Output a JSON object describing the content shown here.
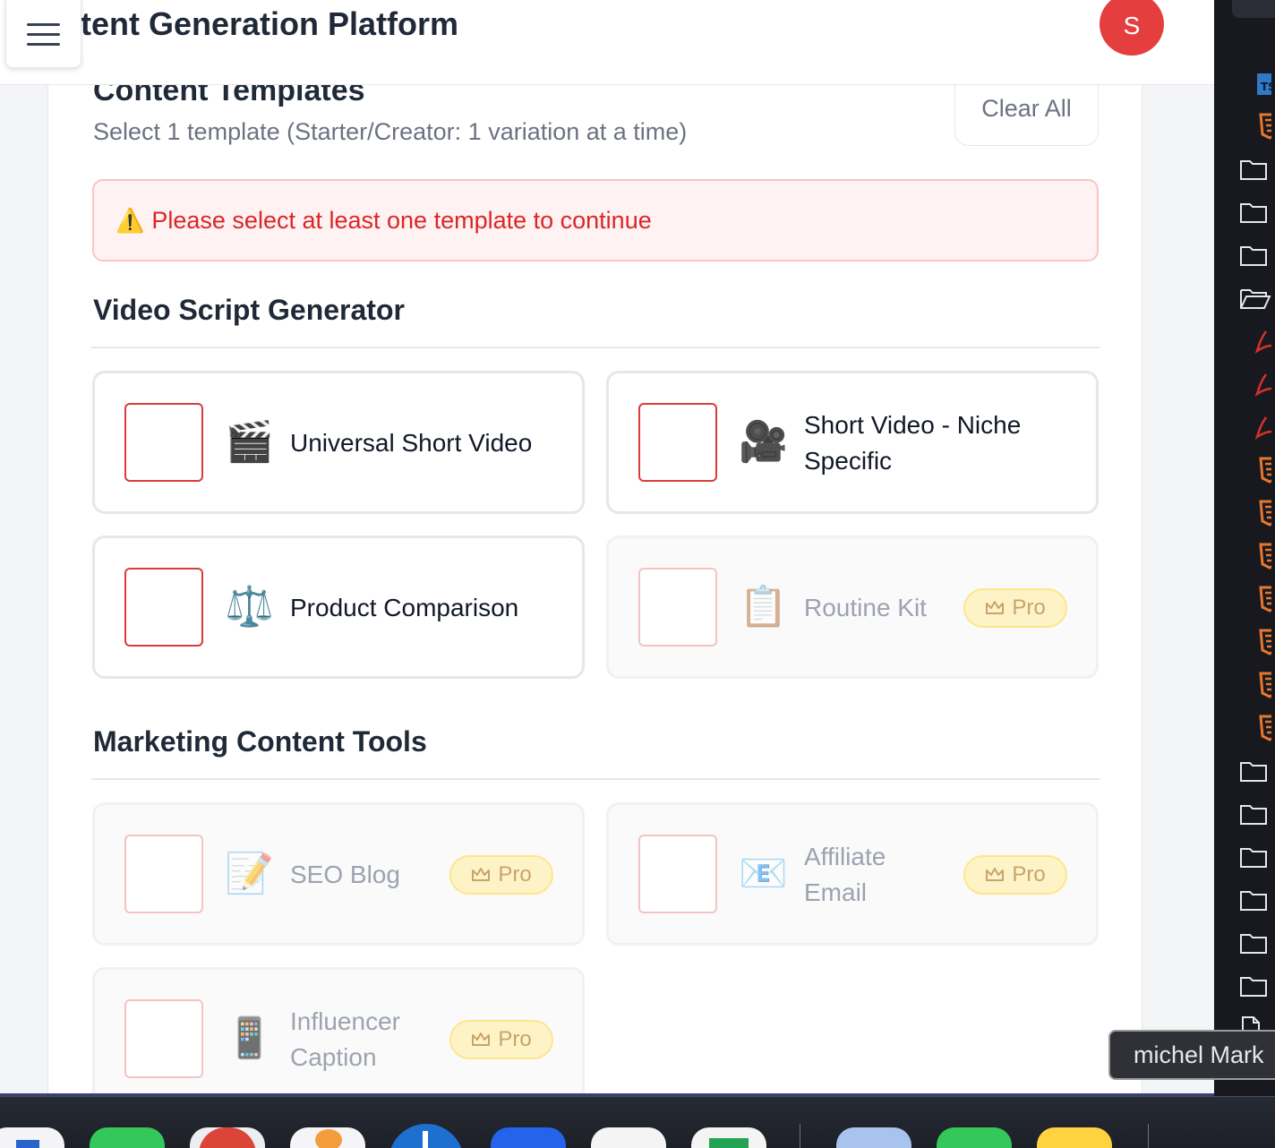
{
  "header": {
    "title": "tent Generation Platform",
    "avatar_letter": "S"
  },
  "templates": {
    "title": "Content Templates",
    "subtitle": "Select 1 template (Starter/Creator: 1 variation at a time)",
    "clear_all_label": "Clear All",
    "alert_icon": "⚠️",
    "alert_text": "Please select at least one template to continue",
    "groups": [
      {
        "title": "Video Script Generator",
        "items": [
          {
            "label": "Universal Short Video",
            "emoji": "🎬",
            "locked": false
          },
          {
            "label": "Short Video - Niche Specific",
            "emoji": "🎥",
            "locked": false
          },
          {
            "label": "Product Comparison",
            "emoji": "⚖️",
            "locked": false
          },
          {
            "label": "Routine Kit",
            "emoji": "📋",
            "locked": true,
            "badge": "Pro"
          }
        ]
      },
      {
        "title": "Marketing Content Tools",
        "items": [
          {
            "label": "SEO Blog",
            "emoji": "📝",
            "locked": true,
            "badge": "Pro"
          },
          {
            "label": "Affiliate Email",
            "emoji": "📧",
            "locked": true,
            "badge": "Pro"
          },
          {
            "label": "Influencer Caption",
            "emoji": "📱",
            "locked": true,
            "badge": "Pro"
          }
        ]
      }
    ]
  },
  "side_panel": {
    "tooltip": "michel Mark",
    "icons": [
      "ts-file-icon",
      "html-file-icon",
      "folder-icon",
      "folder-icon",
      "folder-icon",
      "folder-open-icon",
      "pdf-file-icon",
      "pdf-file-icon",
      "pdf-file-icon",
      "html-file-icon",
      "html-file-icon",
      "html-file-icon",
      "html-file-icon",
      "html-file-icon",
      "html-file-icon",
      "html-file-icon",
      "folder-icon",
      "folder-icon",
      "folder-icon",
      "folder-icon",
      "folder-icon",
      "folder-icon",
      "file-icon"
    ]
  },
  "colors": {
    "accent_red": "#dc2626",
    "avatar": "#e53e3e",
    "pro_badge_bg": "#fef3c7",
    "html_icon": "#e8772e",
    "pdf_icon": "#d6312b"
  }
}
